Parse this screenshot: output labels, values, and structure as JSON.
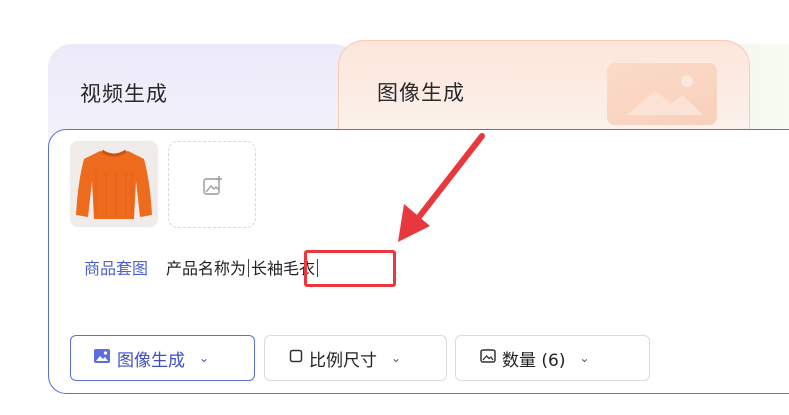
{
  "tabs": [
    {
      "label": "视频生成",
      "active": false
    },
    {
      "label": "图像生成",
      "active": true
    }
  ],
  "composer": {
    "tag_link": "商品套图",
    "prompt_prefix": "产品名称为",
    "variable_value": "长袖毛衣"
  },
  "toolbar": {
    "mode_label": "图像生成",
    "ratio_label": "比例尺寸",
    "count_label": "数量 (6)"
  },
  "colors": {
    "accent": "#5b6fdc",
    "highlight": "#e8383d",
    "arrow": "#e8383d"
  },
  "icons": {
    "mode": "image-icon",
    "ratio": "square-icon",
    "count": "image-outline-icon",
    "upload": "add-image-icon",
    "dropdown": "chevron-down-icon"
  }
}
